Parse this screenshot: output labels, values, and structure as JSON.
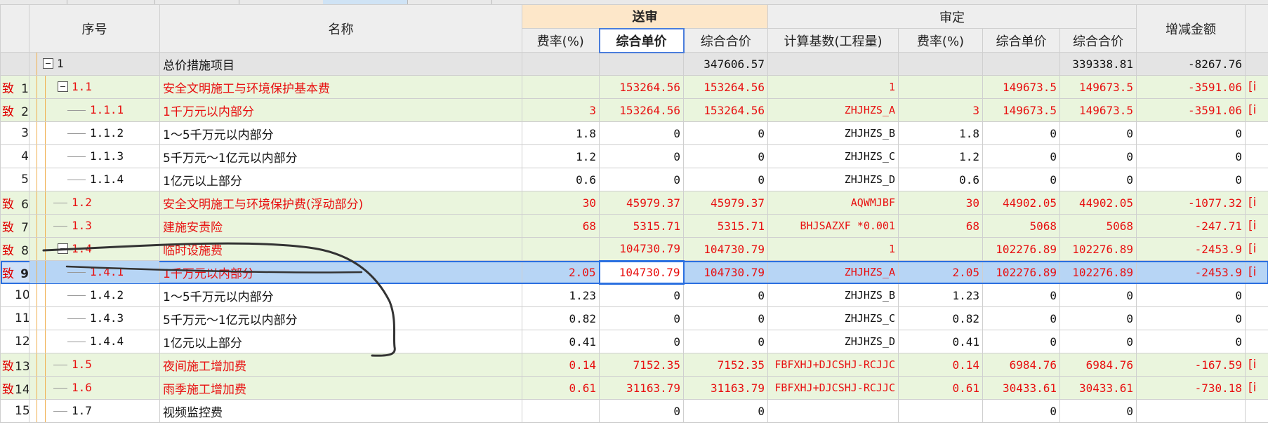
{
  "header": {
    "xuhao": "序号",
    "mingcheng": "名称",
    "songshen": "送审",
    "shending": "审定",
    "zengjian": "增减金额",
    "sub_songshen": [
      "费率(%)",
      "综合单价",
      "综合合价"
    ],
    "sub_shending": [
      "计算基数(工程量)",
      "费率(%)",
      "综合单价",
      "综合合价"
    ]
  },
  "rows": [
    {
      "mark": "",
      "num": "",
      "code": "1",
      "name": "总价措施项目",
      "ss_rate": "",
      "ss_price": "",
      "ss_total": "347606.57",
      "base": "",
      "sd_rate": "",
      "sd_price": "",
      "sd_total": "339338.81",
      "diff": "-8267.76",
      "suffix": ""
    },
    {
      "mark": "致",
      "num": "1",
      "code": "1.1",
      "name": "安全文明施工与环境保护基本费",
      "ss_rate": "",
      "ss_price": "153264.56",
      "ss_total": "153264.56",
      "base": "1",
      "sd_rate": "",
      "sd_price": "149673.5",
      "sd_total": "149673.5",
      "diff": "-3591.06",
      "suffix": "[i"
    },
    {
      "mark": "致",
      "num": "2",
      "code": "1.1.1",
      "name": "1千万元以内部分",
      "ss_rate": "3",
      "ss_price": "153264.56",
      "ss_total": "153264.56",
      "base": "ZHJHZS_A",
      "sd_rate": "3",
      "sd_price": "149673.5",
      "sd_total": "149673.5",
      "diff": "-3591.06",
      "suffix": "[i"
    },
    {
      "mark": "",
      "num": "3",
      "code": "1.1.2",
      "name": "1～5千万元以内部分",
      "ss_rate": "1.8",
      "ss_price": "0",
      "ss_total": "0",
      "base": "ZHJHZS_B",
      "sd_rate": "1.8",
      "sd_price": "0",
      "sd_total": "0",
      "diff": "0",
      "suffix": ""
    },
    {
      "mark": "",
      "num": "4",
      "code": "1.1.3",
      "name": "5千万元～1亿元以内部分",
      "ss_rate": "1.2",
      "ss_price": "0",
      "ss_total": "0",
      "base": "ZHJHZS_C",
      "sd_rate": "1.2",
      "sd_price": "0",
      "sd_total": "0",
      "diff": "0",
      "suffix": ""
    },
    {
      "mark": "",
      "num": "5",
      "code": "1.1.4",
      "name": "1亿元以上部分",
      "ss_rate": "0.6",
      "ss_price": "0",
      "ss_total": "0",
      "base": "ZHJHZS_D",
      "sd_rate": "0.6",
      "sd_price": "0",
      "sd_total": "0",
      "diff": "0",
      "suffix": ""
    },
    {
      "mark": "致",
      "num": "6",
      "code": "1.2",
      "name": "安全文明施工与环境保护费(浮动部分)",
      "ss_rate": "30",
      "ss_price": "45979.37",
      "ss_total": "45979.37",
      "base": "AQWMJBF",
      "sd_rate": "30",
      "sd_price": "44902.05",
      "sd_total": "44902.05",
      "diff": "-1077.32",
      "suffix": "[i"
    },
    {
      "mark": "致",
      "num": "7",
      "code": "1.3",
      "name": "建施安责险",
      "ss_rate": "68",
      "ss_price": "5315.71",
      "ss_total": "5315.71",
      "base": "BHJSAZXF *0.001",
      "sd_rate": "68",
      "sd_price": "5068",
      "sd_total": "5068",
      "diff": "-247.71",
      "suffix": "[i"
    },
    {
      "mark": "致",
      "num": "8",
      "code": "1.4",
      "name": "临时设施费",
      "ss_rate": "",
      "ss_price": "104730.79",
      "ss_total": "104730.79",
      "base": "1",
      "sd_rate": "",
      "sd_price": "102276.89",
      "sd_total": "102276.89",
      "diff": "-2453.9",
      "suffix": "[i"
    },
    {
      "mark": "致",
      "num": "9",
      "code": "1.4.1",
      "name": "1千万元以内部分",
      "ss_rate": "2.05",
      "ss_price": "104730.79",
      "ss_total": "104730.79",
      "base": "ZHJHZS_A",
      "sd_rate": "2.05",
      "sd_price": "102276.89",
      "sd_total": "102276.89",
      "diff": "-2453.9",
      "suffix": "[i"
    },
    {
      "mark": "",
      "num": "10",
      "code": "1.4.2",
      "name": "1～5千万元以内部分",
      "ss_rate": "1.23",
      "ss_price": "0",
      "ss_total": "0",
      "base": "ZHJHZS_B",
      "sd_rate": "1.23",
      "sd_price": "0",
      "sd_total": "0",
      "diff": "0",
      "suffix": ""
    },
    {
      "mark": "",
      "num": "11",
      "code": "1.4.3",
      "name": "5千万元～1亿元以内部分",
      "ss_rate": "0.82",
      "ss_price": "0",
      "ss_total": "0",
      "base": "ZHJHZS_C",
      "sd_rate": "0.82",
      "sd_price": "0",
      "sd_total": "0",
      "diff": "0",
      "suffix": ""
    },
    {
      "mark": "",
      "num": "12",
      "code": "1.4.4",
      "name": "1亿元以上部分",
      "ss_rate": "0.41",
      "ss_price": "0",
      "ss_total": "0",
      "base": "ZHJHZS_D",
      "sd_rate": "0.41",
      "sd_price": "0",
      "sd_total": "0",
      "diff": "0",
      "suffix": ""
    },
    {
      "mark": "致",
      "num": "13",
      "code": "1.5",
      "name": "夜间施工增加费",
      "ss_rate": "0.14",
      "ss_price": "7152.35",
      "ss_total": "7152.35",
      "base": "FBFXHJ+DJCSHJ-RCJJC",
      "sd_rate": "0.14",
      "sd_price": "6984.76",
      "sd_total": "6984.76",
      "diff": "-167.59",
      "suffix": "[i"
    },
    {
      "mark": "致",
      "num": "14",
      "code": "1.6",
      "name": "雨季施工增加费",
      "ss_rate": "0.61",
      "ss_price": "31163.79",
      "ss_total": "31163.79",
      "base": "FBFXHJ+DJCSHJ-RCJJC",
      "sd_rate": "0.61",
      "sd_price": "30433.61",
      "sd_total": "30433.61",
      "diff": "-730.18",
      "suffix": "[i"
    },
    {
      "mark": "",
      "num": "15",
      "code": "1.7",
      "name": "视频监控费",
      "ss_rate": "",
      "ss_price": "0",
      "ss_total": "0",
      "base": "",
      "sd_rate": "",
      "sd_price": "0",
      "sd_total": "0",
      "diff": "",
      "suffix": ""
    }
  ]
}
